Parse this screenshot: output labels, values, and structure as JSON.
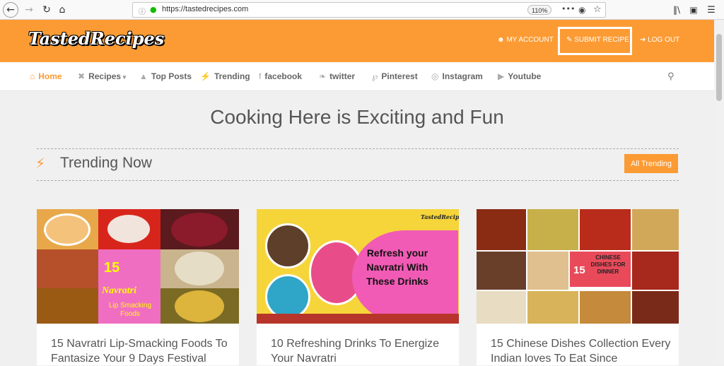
{
  "browser": {
    "url": "https://tastedrecipes.com",
    "zoom": "110%",
    "menu_dots": "•••"
  },
  "header": {
    "logo": "TastedRecipes",
    "my_account": "MY ACCOUNT",
    "submit_recipe": "SUBMIT RECIPE",
    "log_out": "LOG OUT"
  },
  "nav": {
    "items": [
      {
        "label": "Home",
        "icon": "home-icon"
      },
      {
        "label": "Recipes",
        "icon": "utensils-icon"
      },
      {
        "label": "Top Posts",
        "icon": "thumbs-up-icon"
      },
      {
        "label": "Trending",
        "icon": "bolt-icon"
      },
      {
        "label": "facebook",
        "icon": "facebook-icon"
      },
      {
        "label": "twitter",
        "icon": "twitter-icon"
      },
      {
        "label": "Pinterest",
        "icon": "pinterest-icon"
      },
      {
        "label": "Instagram",
        "icon": "instagram-icon"
      },
      {
        "label": "Youtube",
        "icon": "youtube-icon"
      }
    ]
  },
  "main": {
    "tagline": "Cooking Here is Exciting and Fun",
    "section_title": "Trending Now",
    "all_trending": "All Trending",
    "cards": [
      {
        "title": "15 Navratri Lip-Smacking Foods To Fantasize Your 9 Days Festival",
        "img_text_1": "15",
        "img_text_2": "Navratri",
        "img_text_3": "Lip Smacking Foods"
      },
      {
        "title": "10 Refreshing Drinks To Energize Your Navratri",
        "img_text_1": "Refresh your Navratri With These Drinks",
        "img_brand": "TastedRecipes"
      },
      {
        "title": "15 Chinese Dishes Collection Every Indian loves To Eat Since",
        "img_text_1": "15",
        "img_text_2": "CHINESE DISHES FOR DINNER"
      }
    ]
  },
  "colors": {
    "accent": "#fc9b34",
    "text": "#555555"
  }
}
